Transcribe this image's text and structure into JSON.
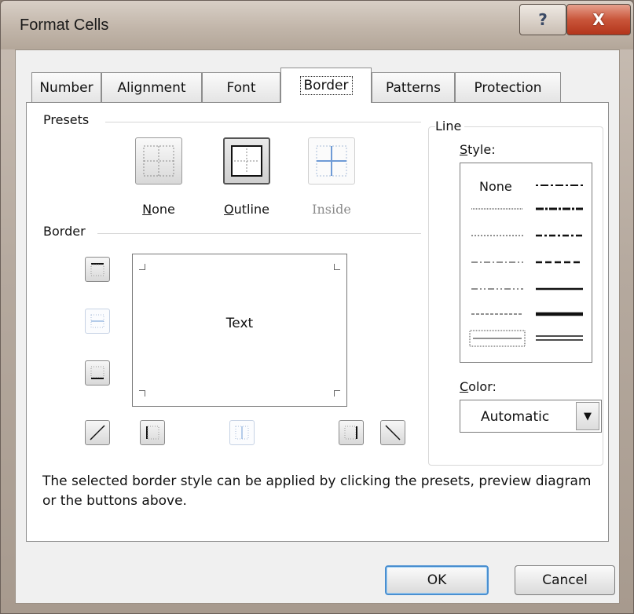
{
  "window": {
    "title": "Format Cells",
    "help_glyph": "?",
    "close_glyph": "X"
  },
  "tabs": [
    {
      "label": "Number"
    },
    {
      "label": "Alignment"
    },
    {
      "label": "Font"
    },
    {
      "label": "Border",
      "active": true
    },
    {
      "label": "Patterns"
    },
    {
      "label": "Protection"
    }
  ],
  "presets": {
    "label": "Presets",
    "items": [
      {
        "label_prefix": "",
        "label_mnemonic": "N",
        "label_rest": "one",
        "enabled": true
      },
      {
        "label_prefix": "",
        "label_mnemonic": "O",
        "label_rest": "utline",
        "enabled": true
      },
      {
        "label_prefix": "",
        "label_mnemonic": "",
        "label_rest": "Inside",
        "enabled": false
      }
    ]
  },
  "border": {
    "label": "Border",
    "preview_text": "Text"
  },
  "line": {
    "label": "Line",
    "style_label_mnemonic": "S",
    "style_label_rest": "tyle:",
    "none_label": "None",
    "color_label_mnemonic": "C",
    "color_label_rest": "olor:",
    "color_value": "Automatic",
    "dropdown_glyph": "▼"
  },
  "hint": "The selected border style can be applied by clicking the presets, preview diagram or the buttons above.",
  "buttons": {
    "ok": "OK",
    "cancel": "Cancel"
  },
  "colors": {
    "close_red": "#c9553a",
    "focus_blue": "#4a8fd0",
    "dialog_bg": "#f0f0f0"
  }
}
